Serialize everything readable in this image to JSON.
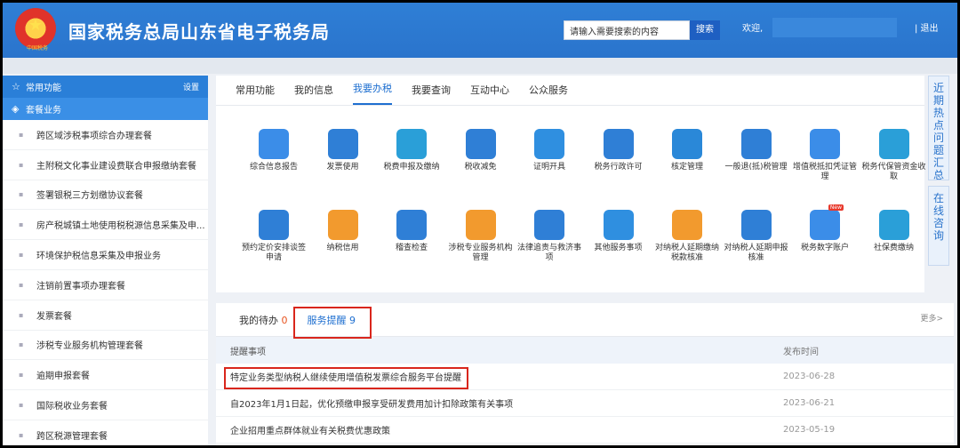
{
  "header": {
    "emblem_text": "中国税务",
    "title": "国家税务总局山东省电子税务局",
    "search_placeholder": "请输入需要搜索的内容",
    "search_button": "搜索",
    "welcome": "欢迎,",
    "logout": "| 退出"
  },
  "sidebar": {
    "favorites_label": "常用功能",
    "settings_label": "设置",
    "package_label": "套餐业务",
    "items": [
      "跨区域涉税事项综合办理套餐",
      "主附税文化事业建设费联合申报缴纳套餐",
      "签署银税三方划缴协议套餐",
      "房产税城镇土地使用税税源信息采集及申...",
      "环境保护税信息采集及申报业务",
      "注销前置事项办理套餐",
      "发票套餐",
      "涉税专业服务机构管理套餐",
      "逾期申报套餐",
      "国际税收业务套餐",
      "跨区税源管理套餐"
    ]
  },
  "main": {
    "tabs": [
      "常用功能",
      "我的信息",
      "我要办税",
      "我要查询",
      "互动中心",
      "公众服务"
    ],
    "active_tab": "我要办税",
    "services": [
      {
        "label": "综合信息报告",
        "icon": "document-icon",
        "color": "#3b8de8"
      },
      {
        "label": "发票使用",
        "icon": "invoice-star-icon",
        "color": "#2f7fd6"
      },
      {
        "label": "税费申报及缴纳",
        "icon": "stack-icon",
        "color": "#2a9fd8"
      },
      {
        "label": "税收减免",
        "icon": "yuan-minus-icon",
        "color": "#2f7fd6"
      },
      {
        "label": "证明开具",
        "icon": "pen-icon",
        "color": "#2f8fe0"
      },
      {
        "label": "税务行政许可",
        "icon": "doc-check-icon",
        "color": "#2f7fd6"
      },
      {
        "label": "核定管理",
        "icon": "folder-icon",
        "color": "#2a88d8"
      },
      {
        "label": "一般退(抵)税管理",
        "icon": "hand-coin-icon",
        "color": "#2f7fd6"
      },
      {
        "label": "增值税抵扣凭证管理",
        "icon": "ledger-icon",
        "color": "#3b8de8"
      },
      {
        "label": "税务代保管资金收取",
        "icon": "doc-yuan-icon",
        "color": "#2a9fd8"
      },
      {
        "label": "预约定价安排谈签申请",
        "icon": "chart-doc-icon",
        "color": "#2f7fd6"
      },
      {
        "label": "纳税信用",
        "icon": "thumbs-up-icon",
        "color": "#f29a2e"
      },
      {
        "label": "稽查检查",
        "icon": "doc-search-icon",
        "color": "#2f7fd6"
      },
      {
        "label": "涉税专业服务机构管理",
        "icon": "umbrella-icon",
        "color": "#f29a2e"
      },
      {
        "label": "法律追责与救济事项",
        "icon": "gavel-icon",
        "color": "#2f7fd6"
      },
      {
        "label": "其他服务事项",
        "icon": "grid-icon",
        "color": "#2f8fe0"
      },
      {
        "label": "对纳税人延期缴纳税款核准",
        "icon": "person-extend-icon",
        "color": "#f29a2e"
      },
      {
        "label": "对纳税人延期申报核准",
        "icon": "wallet-icon",
        "color": "#2f7fd6"
      },
      {
        "label": "税务数字账户",
        "icon": "account-icon",
        "color": "#3b8de8",
        "badge": "New"
      },
      {
        "label": "社保费缴纳",
        "icon": "heart-hands-icon",
        "color": "#2a9fd8"
      }
    ]
  },
  "side_tabs": [
    "近期热点问题汇总",
    "在线咨询"
  ],
  "notices": {
    "tabs": [
      {
        "label": "我的待办",
        "count": "0"
      },
      {
        "label": "服务提醒",
        "count": "9"
      }
    ],
    "more": "更多>",
    "col_item": "提醒事项",
    "col_date": "发布时间",
    "rows": [
      {
        "title": "特定业务类型纳税人继续使用增值税发票综合服务平台提醒",
        "date": "2023-06-28"
      },
      {
        "title": "自2023年1月1日起，优化预缴申报享受研发费用加计扣除政策有关事项",
        "date": "2023-06-21"
      },
      {
        "title": "企业招用重点群体就业有关税费优惠政策",
        "date": "2023-05-19"
      }
    ]
  }
}
